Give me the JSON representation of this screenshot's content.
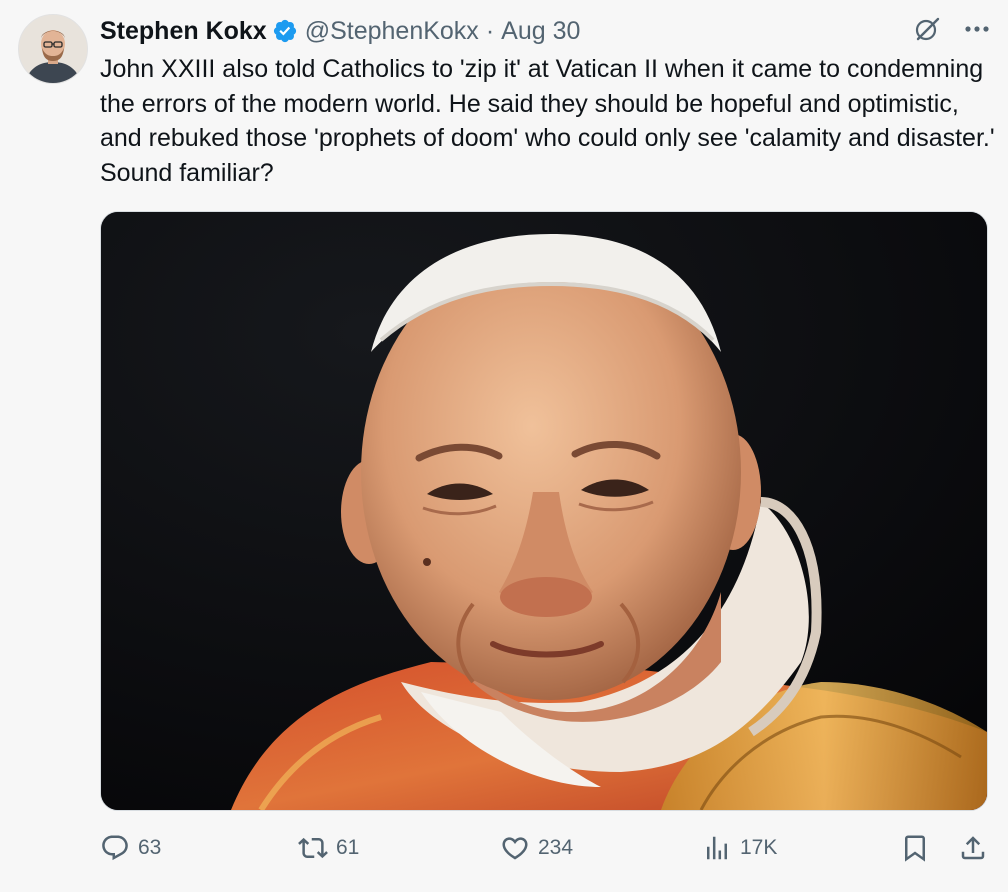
{
  "author": {
    "display_name": "Stephen Kokx",
    "handle": "@StephenKokx",
    "separator": "·",
    "date": "Aug 30",
    "verified": true
  },
  "tweet": {
    "text": "John XXIII also told Catholics to 'zip it' at Vatican II when it came to condemning the errors of the modern world. He said they should be hopeful and optimistic, and rebuked those 'prophets of doom' who could only see 'calamity and disaster.' Sound familiar?"
  },
  "media": {
    "alt": "Portrait of Pope John XXIII"
  },
  "actions": {
    "replies": "63",
    "reposts": "61",
    "likes": "234",
    "views": "17K"
  },
  "colors": {
    "text_primary": "#0f1419",
    "text_secondary": "#536471",
    "verified_blue": "#1d9bf0",
    "background": "#f7f7f7"
  },
  "icons": [
    "grok-icon",
    "more-icon",
    "verified-badge-icon",
    "reply-icon",
    "repost-icon",
    "like-icon",
    "views-icon",
    "bookmark-icon",
    "share-icon"
  ]
}
